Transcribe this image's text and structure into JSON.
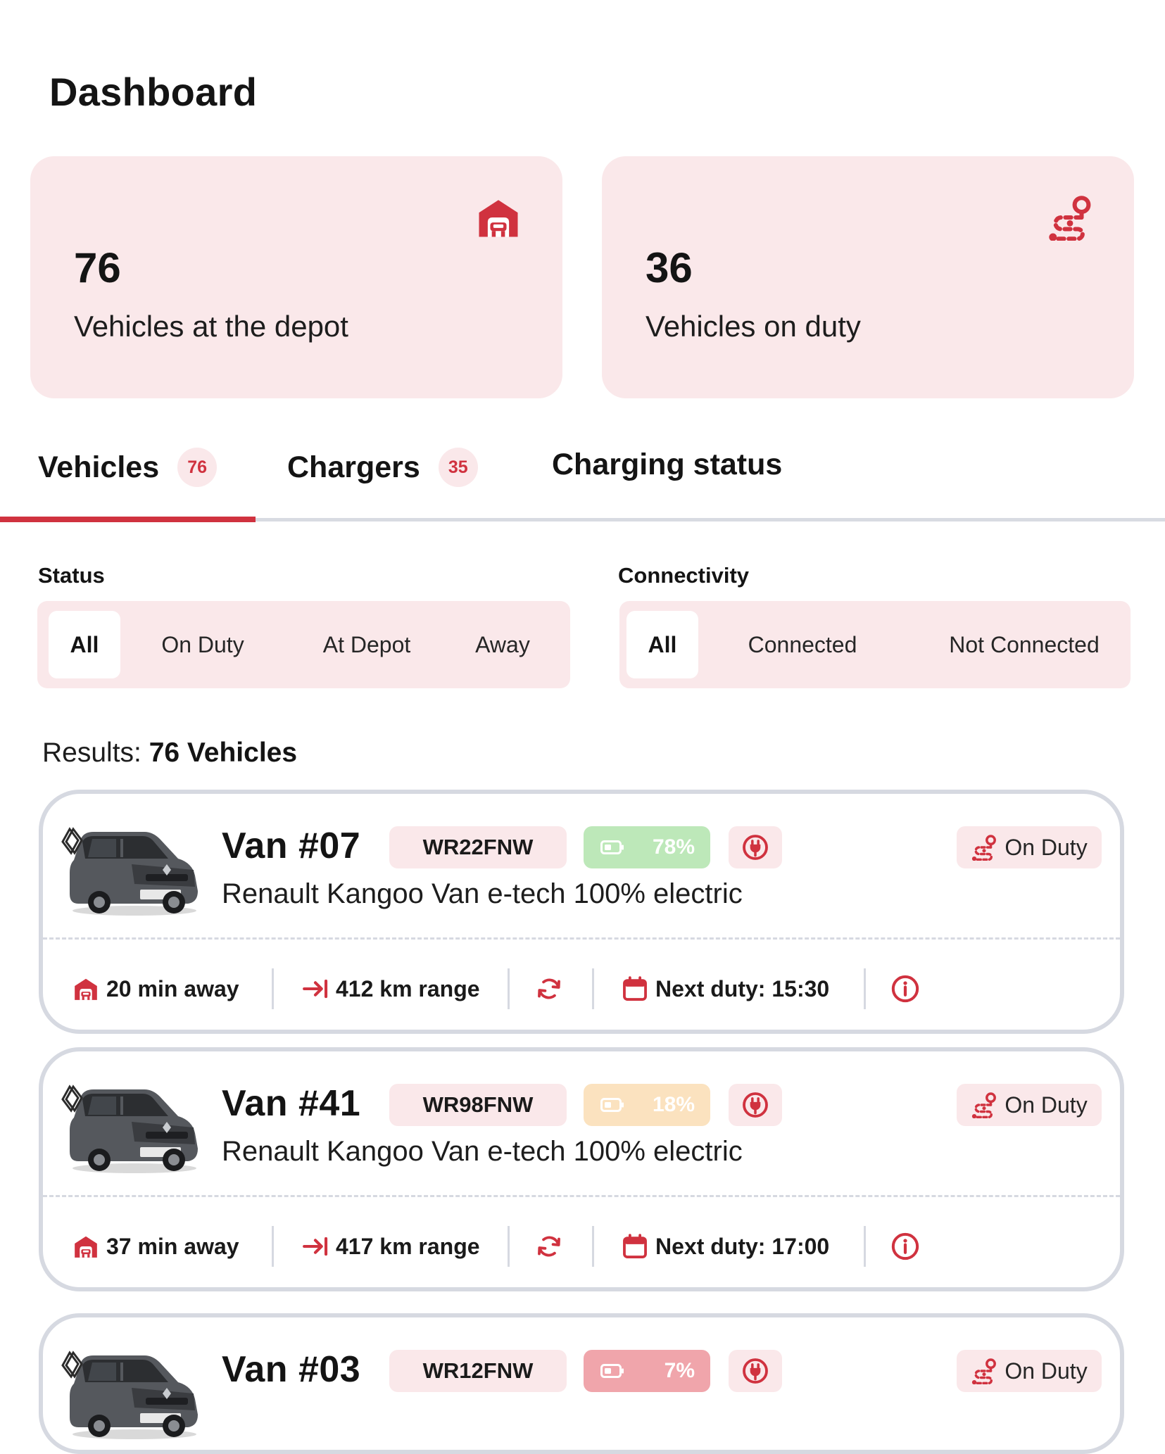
{
  "page": {
    "title": "Dashboard"
  },
  "stats": [
    {
      "value": "76",
      "label": "Vehicles at the depot",
      "icon": "garage-icon"
    },
    {
      "value": "36",
      "label": "Vehicles on duty",
      "icon": "route-icon"
    }
  ],
  "tabs": [
    {
      "label": "Vehicles",
      "count": "76",
      "active": true
    },
    {
      "label": "Chargers",
      "count": "35"
    },
    {
      "label": "Charging status"
    }
  ],
  "filters": {
    "status": {
      "label": "Status",
      "options": [
        "All",
        "On Duty",
        "At Depot",
        "Away"
      ],
      "selected": "All"
    },
    "connectivity": {
      "label": "Connectivity",
      "options": [
        "All",
        "Connected",
        "Not Connected"
      ],
      "selected": "All"
    }
  },
  "results": {
    "prefix": "Results: ",
    "count_text": "76 Vehicles"
  },
  "colors": {
    "accent": "#d0323f",
    "card_bg": "#fae8ea",
    "border": "#d6d9e1",
    "battery_high": "#bde8b9",
    "battery_mid": "#fbe2bf",
    "battery_low": "#f0a5ab"
  },
  "vehicles": [
    {
      "name": "Van #07",
      "plate": "WR22FNW",
      "battery": "78%",
      "battery_color": "#bde8b9",
      "model": "Renault Kangoo Van e-tech 100% electric",
      "status": "On Duty",
      "distance": "20 min away",
      "range": "412 km range",
      "next_duty": "Next duty: 15:30"
    },
    {
      "name": "Van #41",
      "plate": "WR98FNW",
      "battery": "18%",
      "battery_color": "#fbe2bf",
      "model": "Renault Kangoo Van e-tech 100% electric",
      "status": "On Duty",
      "distance": "37 min away",
      "range": "417 km range",
      "next_duty": "Next duty: 17:00"
    },
    {
      "name": "Van #03",
      "plate": "WR12FNW",
      "battery": "7%",
      "battery_color": "#f0a5ab",
      "model": "Renault Kangoo Van e-tech 100% electric",
      "status": "On Duty",
      "distance": "",
      "range": "",
      "next_duty": ""
    }
  ]
}
